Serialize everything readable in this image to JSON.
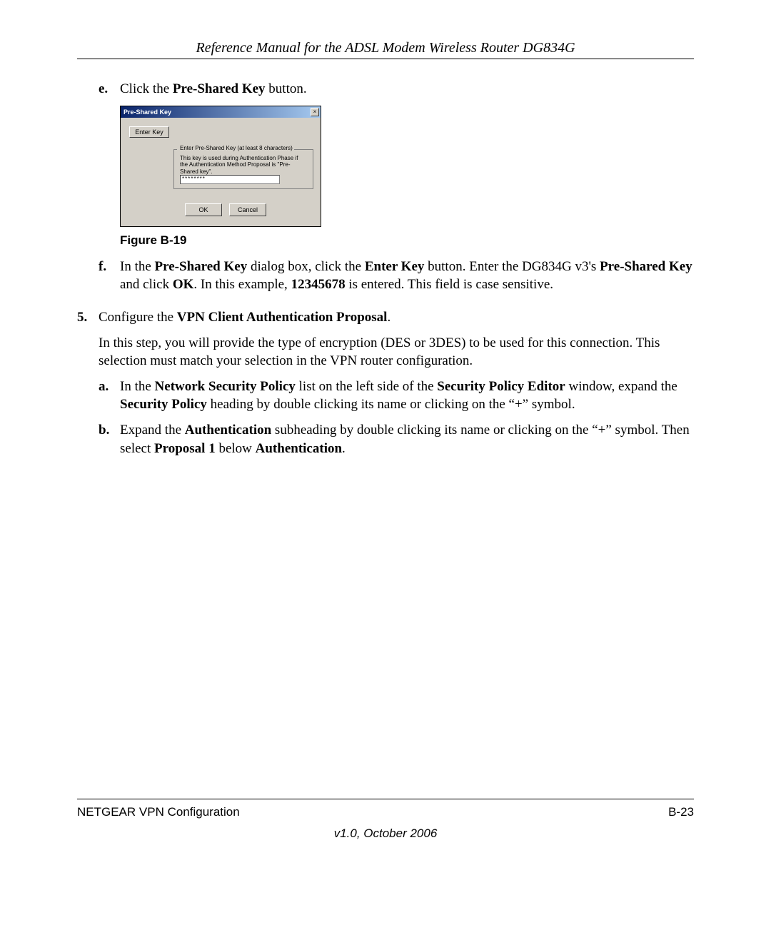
{
  "header": {
    "title": "Reference Manual for the ADSL Modem Wireless Router DG834G"
  },
  "steps": {
    "e": {
      "marker": "e.",
      "pre": "Click the ",
      "bold": "Pre-Shared Key",
      "post": " button."
    },
    "f": {
      "marker": "f.",
      "t1": "In the ",
      "b1": "Pre-Shared Key",
      "t2": " dialog box, click the ",
      "b2": "Enter Key",
      "t3": " button. Enter the DG834G v3's ",
      "b3": "Pre-Shared Key",
      "t4": " and click ",
      "b4": "OK",
      "t5": ". In this example, ",
      "b5": "12345678",
      "t6": " is entered. This field is case sensitive."
    },
    "s5": {
      "marker": "5.",
      "t1": "Configure the ",
      "b1": "VPN Client Authentication Proposal",
      "t2": "."
    },
    "s5para": "In this step, you will provide the type of encryption (DES or 3DES) to be used for this connection. This selection must match your selection in the VPN router configuration.",
    "a": {
      "marker": "a.",
      "t1": "In the ",
      "b1": "Network Security Policy",
      "t2": " list on the left side of the ",
      "b2": "Security Policy Editor",
      "t3": " window, expand the ",
      "b3": "Security Policy",
      "t4": " heading by double clicking its name or clicking on the “+” symbol."
    },
    "b": {
      "marker": "b.",
      "t1": "Expand the ",
      "b1": "Authentication",
      "t2": " subheading by double clicking its name or clicking on the “+” symbol. Then select ",
      "b2": "Proposal 1",
      "t3": " below ",
      "b3": "Authentication",
      "t4": "."
    }
  },
  "figure": {
    "caption": "Figure B-19",
    "dialog": {
      "title": "Pre-Shared Key",
      "close": "×",
      "enter_key_btn": "Enter Key",
      "legend": "Enter Pre-Shared Key (at least 8 characters)",
      "help_text": "This key is used during Authentication Phase if the Authentication Method Proposal is \"Pre-Shared key\".",
      "input_value": "********",
      "ok": "OK",
      "cancel": "Cancel"
    }
  },
  "footer": {
    "left": "NETGEAR VPN Configuration",
    "right": "B-23",
    "version": "v1.0, October 2006"
  }
}
